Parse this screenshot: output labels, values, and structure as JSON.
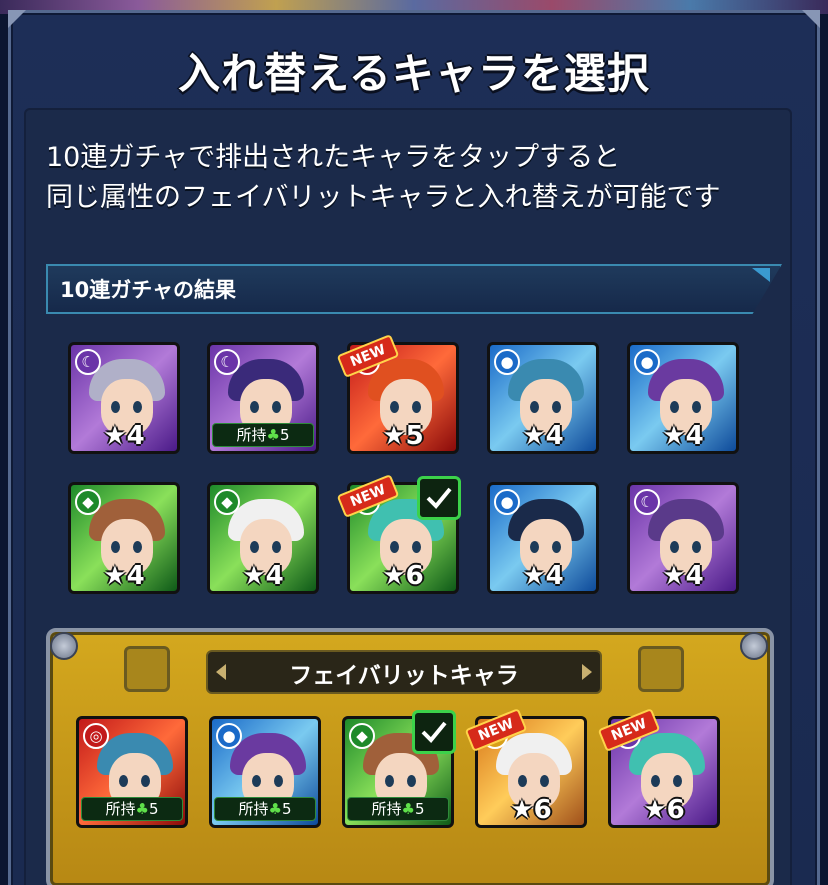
{
  "dialog": {
    "title": "入れ替えるキャラを選択",
    "description_line1": "10連ガチャで排出されたキャラをタップすると",
    "description_line2": "同じ属性のフェイバリットキャラと入れ替えが可能です"
  },
  "gacha_section": {
    "label": "10連ガチャの結果",
    "characters": [
      {
        "element": "dark",
        "rarity": "★4",
        "owned": "",
        "new": false,
        "checked": false
      },
      {
        "element": "dark",
        "rarity": "",
        "owned": "所持",
        "owned_count": "5",
        "new": false,
        "checked": false
      },
      {
        "element": "fire",
        "rarity": "★5",
        "owned": "",
        "new": true,
        "checked": false
      },
      {
        "element": "water",
        "rarity": "★4",
        "owned": "",
        "new": false,
        "checked": false
      },
      {
        "element": "water",
        "rarity": "★4",
        "owned": "",
        "new": false,
        "checked": false
      },
      {
        "element": "wood",
        "rarity": "★4",
        "owned": "",
        "new": false,
        "checked": false
      },
      {
        "element": "wood",
        "rarity": "★4",
        "owned": "",
        "new": false,
        "checked": false
      },
      {
        "element": "wood",
        "rarity": "★6",
        "owned": "",
        "new": true,
        "checked": true
      },
      {
        "element": "water",
        "rarity": "★4",
        "owned": "",
        "new": false,
        "checked": false
      },
      {
        "element": "dark",
        "rarity": "★4",
        "owned": "",
        "new": false,
        "checked": false
      }
    ]
  },
  "favorite_section": {
    "label": "フェイバリットキャラ",
    "characters": [
      {
        "element": "fire",
        "rarity": "",
        "owned": "所持",
        "owned_count": "5",
        "new": false,
        "checked": false
      },
      {
        "element": "water",
        "rarity": "",
        "owned": "所持",
        "owned_count": "5",
        "new": false,
        "checked": false
      },
      {
        "element": "wood",
        "rarity": "",
        "owned": "所持",
        "owned_count": "5",
        "new": false,
        "checked": true
      },
      {
        "element": "light",
        "rarity": "★6",
        "owned": "",
        "new": true,
        "checked": false
      },
      {
        "element": "dark",
        "rarity": "★6",
        "owned": "",
        "new": true,
        "checked": false
      }
    ]
  },
  "badges": {
    "new_label": "NEW",
    "clover": "♣"
  },
  "colors": {
    "fire": "#c21a1a",
    "water": "#1a6ac8",
    "wood": "#1e8a2a",
    "light": "#d8a01a",
    "dark": "#6a34a8",
    "check": "#3cd24a"
  }
}
